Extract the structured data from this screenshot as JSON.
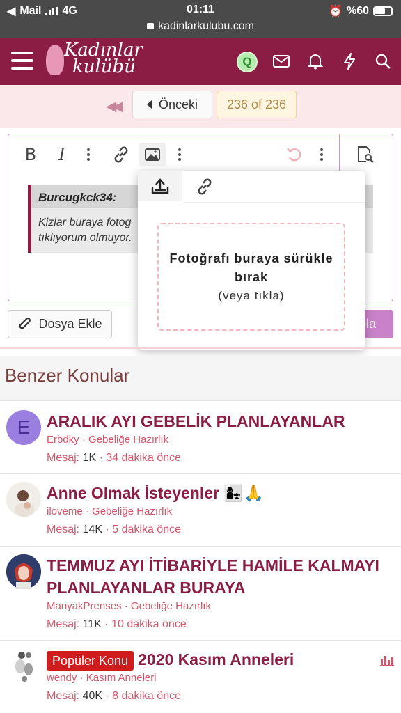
{
  "status": {
    "carrier": "Mail",
    "network": "4G",
    "time": "01:11",
    "battery": "%60"
  },
  "url": "kadinlarkulubu.com",
  "nav": {
    "logo_line1": "Kadınlar",
    "logo_line2": "kulübü",
    "avatar_letter": "Q"
  },
  "pager": {
    "prev_label": "Önceki",
    "count": "236 of 236"
  },
  "editor": {
    "bold": "B",
    "italic": "I",
    "quote_author": "Burcugkck34:",
    "quote_text_line1": "Kizlar buraya fotog",
    "quote_text_line2": "tıklıyorum olmuyor."
  },
  "popup": {
    "drop_line1": "Fotoğrafı buraya sürükle",
    "drop_line2": "bırak",
    "drop_line3": "(veya tıkla)"
  },
  "attach_label": "Dosya Ekle",
  "post_label_partial": "pla",
  "similar": {
    "heading": "Benzer Konular",
    "items": [
      {
        "avatar_letter": "E",
        "title": "ARALIK AYI GEBELİK PLANLAYANLAR",
        "author": "Erbdky",
        "forum": "Gebeliğe Hazırlık",
        "msg_label": "Mesaj:",
        "msg_count": "1K",
        "time": "34 dakika önce"
      },
      {
        "title": "Anne Olmak İsteyenler 👩‍👧🙏",
        "author": "iloveme",
        "forum": "Gebeliğe Hazırlık",
        "msg_label": "Mesaj:",
        "msg_count": "14K",
        "time": "5 dakika önce"
      },
      {
        "title": "TEMMUZ AYI İTİBARİYLE HAMİLE KALMAYI PLANLAYANLAR BURAYA",
        "author": "ManyakPrenses",
        "forum": "Gebeliğe Hazırlık",
        "msg_label": "Mesaj:",
        "msg_count": "11K",
        "time": "10 dakika önce"
      },
      {
        "badge": "Popüler Konu",
        "title": "2020 Kasım Anneleri",
        "author": "wendy",
        "forum": "Kasım Anneleri",
        "msg_label": "Mesaj:",
        "msg_count": "40K",
        "time": "8 dakika önce"
      }
    ]
  },
  "colors": {
    "brand": "#8b1d44",
    "pink": "#d5566a",
    "badge": "#d01c1c"
  }
}
